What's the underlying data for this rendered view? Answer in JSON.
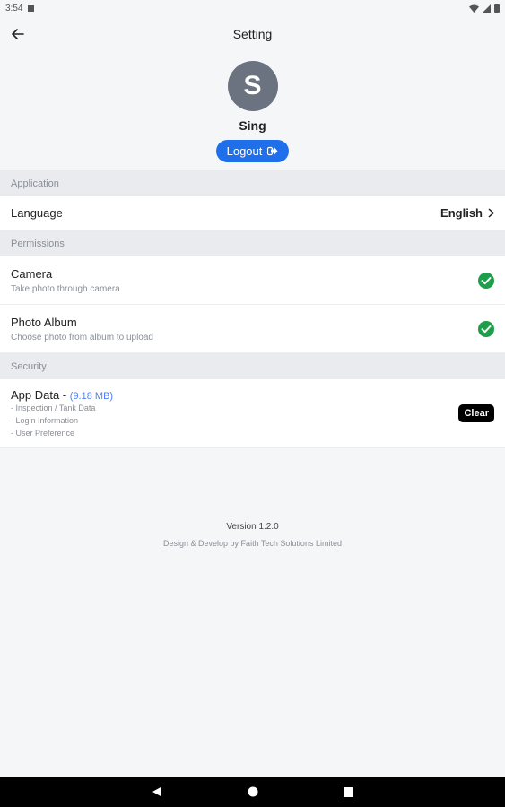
{
  "status_bar": {
    "time": "3:54"
  },
  "header": {
    "title": "Setting",
    "back_icon": "arrow-left-icon"
  },
  "profile": {
    "avatar_initial": "S",
    "name": "Sing",
    "logout_label": "Logout",
    "logout_icon": "sign-out-icon",
    "avatar_color": "#6b7280",
    "button_color": "#1f6feb"
  },
  "sections": {
    "application": {
      "title": "Application",
      "language": {
        "label": "Language",
        "value": "English"
      }
    },
    "permissions": {
      "title": "Permissions",
      "camera": {
        "label": "Camera",
        "description": "Take photo through camera",
        "granted": true
      },
      "photo_album": {
        "label": "Photo Album",
        "description": "Choose photo from album to upload",
        "granted": true
      }
    },
    "security": {
      "title": "Security",
      "app_data": {
        "label": "App Data -",
        "size": "(9.18 MB)",
        "items": [
          "- Inspection / Tank Data",
          "- Login Information",
          "- User Preference"
        ],
        "clear_label": "Clear"
      }
    }
  },
  "footer": {
    "version": "Version 1.2.0",
    "credit": "Design & Develop by Faith Tech Solutions Limited"
  },
  "colors": {
    "check_green": "#1e9e4a",
    "accent_blue": "#4f7df7"
  }
}
